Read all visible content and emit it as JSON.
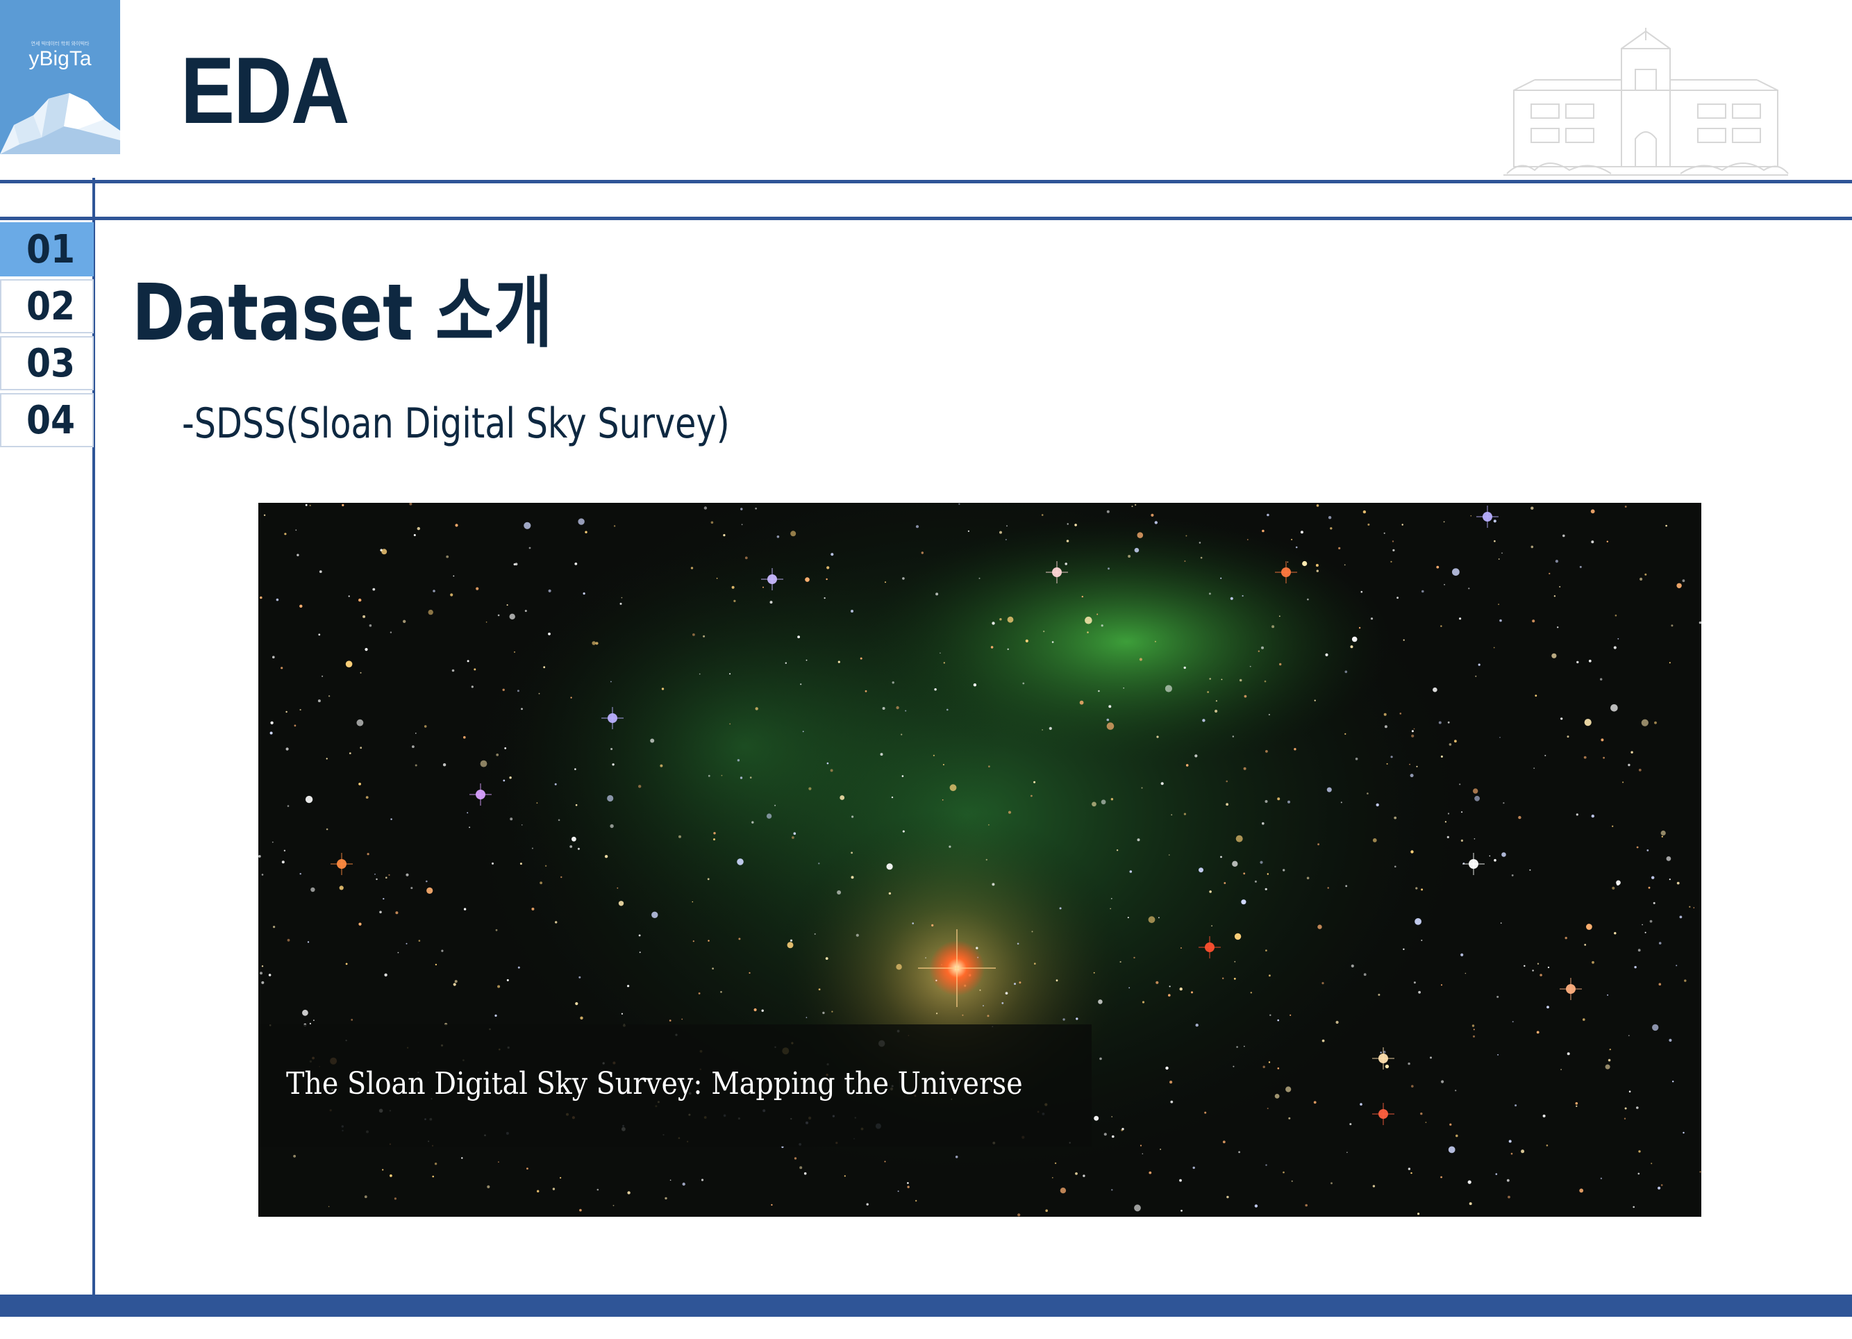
{
  "logo": {
    "name": "yBigTa",
    "tagline": "연세 빅데이터 학회 와이빅타"
  },
  "header": {
    "title": "EDA"
  },
  "nav": {
    "items": [
      {
        "label": "01",
        "active": true
      },
      {
        "label": "02",
        "active": false
      },
      {
        "label": "03",
        "active": false
      },
      {
        "label": "04",
        "active": false
      }
    ]
  },
  "content": {
    "section_title": "Dataset 소개",
    "subtitle": "-SDSS(Sloan Digital Sky Survey)",
    "image_caption": "The Sloan Digital Sky Survey: Mapping the Universe"
  },
  "colors": {
    "navy": "#0e2841",
    "rule": "#2f5597",
    "logo_bg": "#5b9bd5",
    "nav_active": "#6aaae6"
  }
}
